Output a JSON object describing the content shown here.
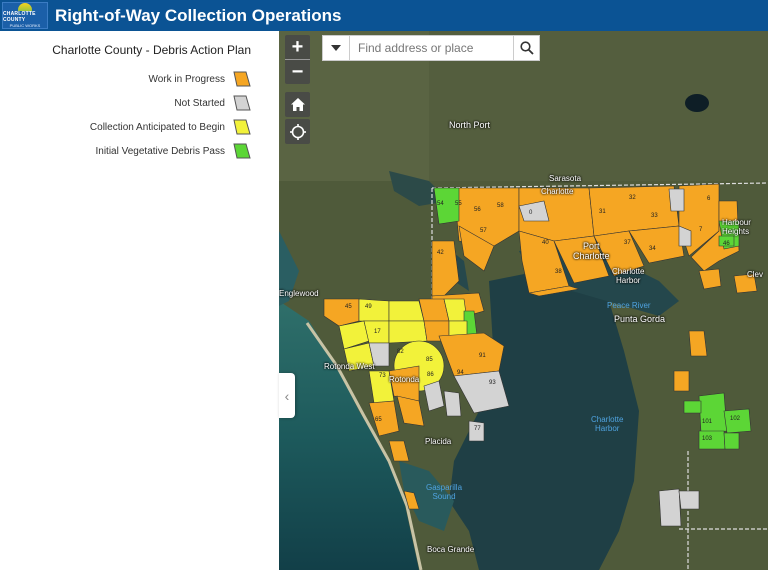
{
  "header": {
    "logo_line1": "CHARLOTTE COUNTY",
    "logo_line2": "PUBLIC WORKS",
    "title": "Right-of-Way Collection Operations"
  },
  "legend": {
    "title": "Charlotte County - Debris Action Plan",
    "items": [
      {
        "label": "Work in Progress",
        "color": "#f5a623"
      },
      {
        "label": "Not Started",
        "color": "#d3d3d3"
      },
      {
        "label": "Collection Anticipated to Begin",
        "color": "#f2f23a"
      },
      {
        "label": "Initial Vegetative Debris Pass",
        "color": "#5cd636"
      }
    ]
  },
  "search": {
    "placeholder": "Find address or place"
  },
  "controls": {
    "zoom_in": "+",
    "zoom_out": "−",
    "home_icon": "home-icon",
    "locate_icon": "locate-icon",
    "collapse": "‹"
  },
  "places": {
    "north_port": "North Port",
    "sarasota": "Sarasota",
    "charlotte": "Charlotte",
    "harbour_heights": "Harbour\nHeights",
    "port_charlotte": "Port\nCharlotte",
    "charlotte_harbor": "Charlotte\nHarbor",
    "englewood": "Englewood",
    "punta_gorda": "Punta Gorda",
    "rotonda_west": "Rotonda West",
    "rotonda": "Rotonda",
    "placida": "Placida",
    "boca_grande": "Boca Grande",
    "cleveland": "Clev"
  },
  "water": {
    "peace_river": "Peace River",
    "charlotte_harbor_water": "Charlotte\nHarbor",
    "gasparilla_sound": "Gasparilla\nSound"
  },
  "zones": {
    "z54": "54",
    "z55": "55",
    "z56": "56",
    "z58": "58",
    "z0": "0",
    "z31": "31",
    "z32": "32",
    "z33": "33",
    "z37": "37",
    "z34": "34",
    "z40": "40",
    "z38": "38",
    "z57": "57",
    "z42": "42",
    "z6": "6",
    "z7": "7",
    "z46": "46",
    "z45": "45",
    "z49": "49",
    "z17": "17",
    "z82": "82",
    "z85": "85",
    "z86": "86",
    "z91": "91",
    "z93": "93",
    "z94": "94",
    "z73": "73",
    "z65": "65",
    "z77": "77",
    "z101": "101",
    "z102": "102",
    "z103": "103"
  }
}
